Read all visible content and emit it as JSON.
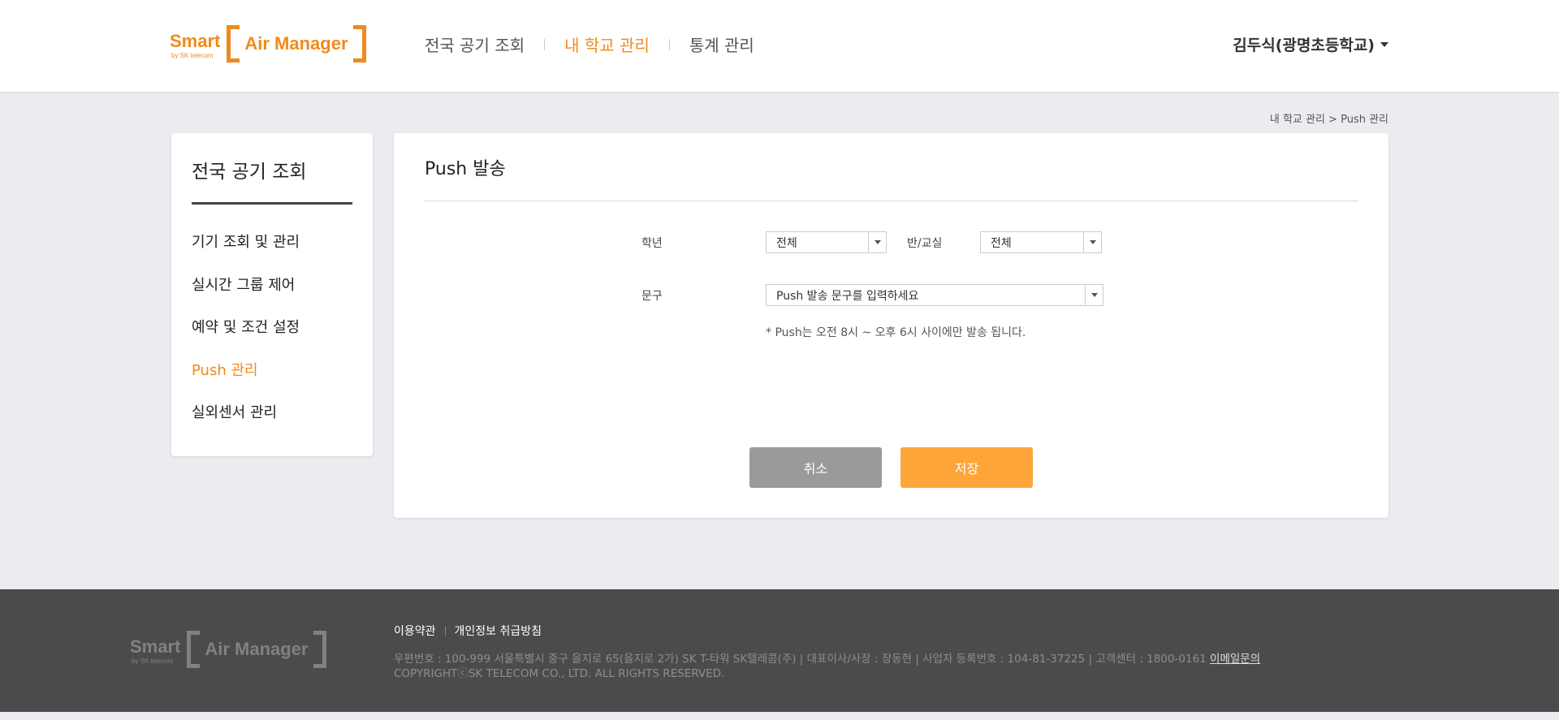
{
  "header": {
    "logo": {
      "smart": "Smart",
      "by": "by SK telecom",
      "air_manager": "Air Manager"
    },
    "nav": [
      "전국 공기 조회",
      "내 학교 관리",
      "통계 관리"
    ],
    "active_nav": 1,
    "user": "김두식(광명초등학교)"
  },
  "breadcrumb": "내 학교 관리 > Push 관리",
  "sidebar": {
    "title": "전국 공기 조회",
    "items": [
      {
        "label": "기기 조회 및 관리"
      },
      {
        "label": "실시간 그룹 제어"
      },
      {
        "label": "예약 및 조건 설정"
      },
      {
        "label": "Push 관리"
      },
      {
        "label": "실외센서 관리"
      }
    ],
    "active_index": 3
  },
  "main": {
    "title": "Push 발송",
    "grade_label": "학년",
    "grade_value": "전체",
    "class_label": "반/교실",
    "class_value": "전체",
    "phrase_label": "문구",
    "phrase_placeholder": "Push 발송 문구를 입력하세요",
    "note": "* Push는 오전 8시 ~ 오후 6시 사이에만 발송 됩니다.",
    "cancel_label": "취소",
    "save_label": "저장"
  },
  "footer": {
    "links": [
      "이용약관",
      "개인정보 취급방침"
    ],
    "address": "우편번호 : 100-999 서울특별시 중구 을지로 65(을지로 2가) SK T-타워 SK텔레콤(주) | 대표이사/사장 : 장동현 | 사업자 등록번호 : 104-81-37225 | 고객센터 : 1800-0161",
    "email_link": "이메일문의",
    "copyright": "COPYRIGHTⓒSK TELECOM CO., LTD. ALL RIGHTS RESERVED."
  },
  "colors": {
    "accent": "#f08a1c",
    "save_button": "#fea53a",
    "cancel_button": "#9a9a9a",
    "footer_bg": "#4a4b4d",
    "page_bg": "#ebecef"
  }
}
